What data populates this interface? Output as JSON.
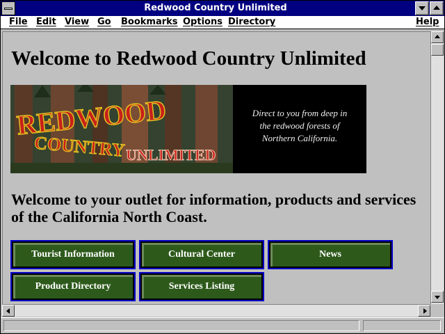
{
  "window": {
    "title": "Redwood Country Unlimited"
  },
  "menu": {
    "items": [
      "File",
      "Edit",
      "View",
      "Go",
      "Bookmarks",
      "Options",
      "Directory"
    ],
    "help": "Help"
  },
  "page": {
    "heading": "Welcome to Redwood Country Unlimited",
    "banner": {
      "logo_line1": "REDWOOD",
      "logo_line2": "COUNTRY",
      "logo_line3": "UNLIMITED",
      "tagline": [
        "Direct to you from deep in",
        "the redwood forests of",
        "Northern California."
      ]
    },
    "intro": "Welcome to your outlet for information, products and services of the California North Coast.",
    "nav": {
      "tourist": "Tourist Information",
      "cultural": "Cultural Center",
      "news": "News",
      "products": "Product Directory",
      "services": "Services Listing"
    }
  },
  "colors": {
    "titlebar": "#000080",
    "button_fill": "#2d5a1b",
    "button_border": "#0000c8",
    "logo_red": "#c8201a",
    "logo_yellow": "#e0c020"
  }
}
